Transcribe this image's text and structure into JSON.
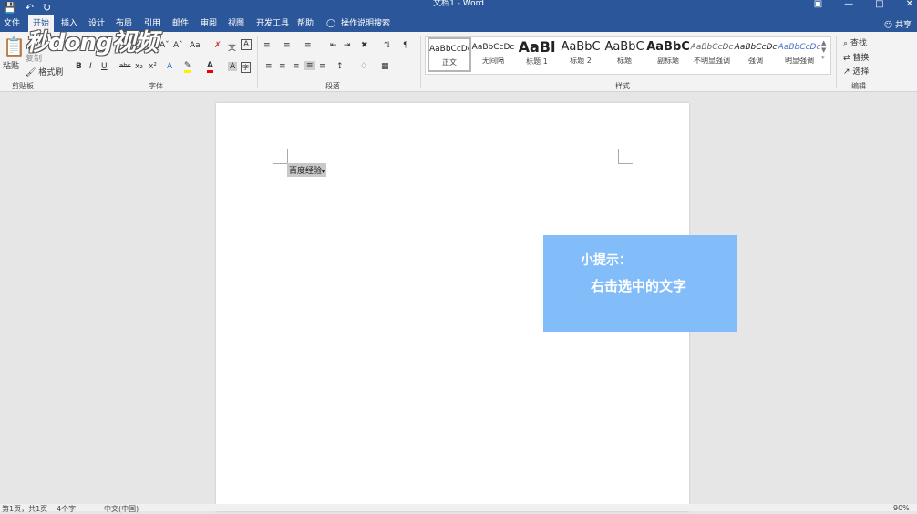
{
  "window": {
    "doc_title": "文档1 - Word"
  },
  "watermark": {
    "text": "秒dong视频"
  },
  "tabs": [
    {
      "label": "文件"
    },
    {
      "label": "开始"
    },
    {
      "label": "插入"
    },
    {
      "label": "设计"
    },
    {
      "label": "布局"
    },
    {
      "label": "引用"
    },
    {
      "label": "邮件"
    },
    {
      "label": "审阅"
    },
    {
      "label": "视图"
    },
    {
      "label": "开发工具"
    },
    {
      "label": "帮助"
    }
  ],
  "tell_me": "操作说明搜索",
  "share": "共享",
  "clipboard": {
    "paste": "粘贴",
    "copy": "复制",
    "format_painter": "格式刷",
    "label": "剪贴板"
  },
  "font_group": {
    "label": "字体",
    "size_label": "Aa"
  },
  "paragraph_group": {
    "label": "段落"
  },
  "styles_group": {
    "label": "样式",
    "items": [
      {
        "sample": "AaBbCcDc",
        "name": "正文"
      },
      {
        "sample": "AaBbCcDc",
        "name": "无间隔"
      },
      {
        "sample": "AaBl",
        "name": "标题 1"
      },
      {
        "sample": "AaBbC",
        "name": "标题 2"
      },
      {
        "sample": "AaBbC",
        "name": "标题"
      },
      {
        "sample": "AaBbC",
        "name": "副标题"
      },
      {
        "sample": "AaBbCcDc",
        "name": "不明显强调"
      },
      {
        "sample": "AaBbCcDc",
        "name": "强调"
      },
      {
        "sample": "AaBbCcDc",
        "name": "明显强调"
      }
    ]
  },
  "editing_group": {
    "find": "查找",
    "replace": "替换",
    "select": "选择",
    "label": "编辑"
  },
  "document": {
    "selected_text": "百度经验"
  },
  "hint": {
    "title": "小提示：",
    "body": "右击选中的文字"
  },
  "status": {
    "page": "第1页，共1页",
    "words": "4个字",
    "lang": "中文(中国)",
    "zoom": "90%"
  }
}
